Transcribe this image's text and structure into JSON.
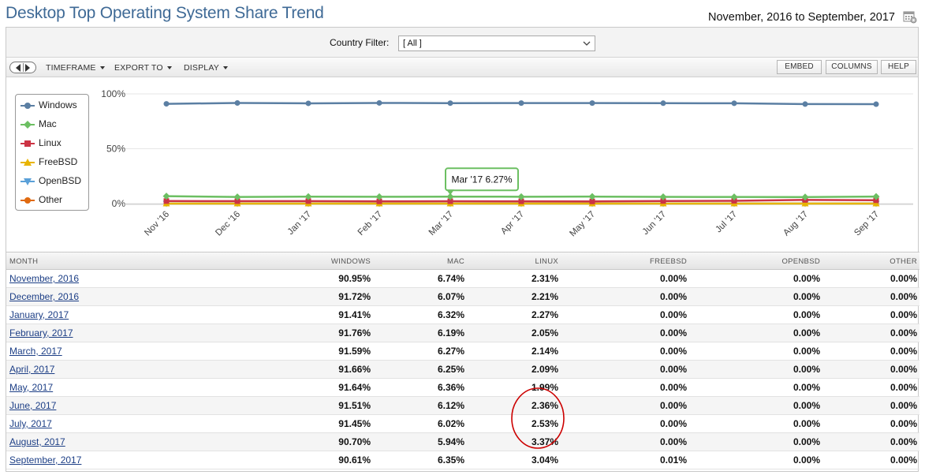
{
  "header": {
    "title": "Desktop Top Operating System Share Trend",
    "date_range": "November, 2016 to September, 2017"
  },
  "filter": {
    "label": "Country Filter:",
    "value": "[ All ]"
  },
  "toolbar": {
    "timeframe": "TIMEFRAME",
    "export": "EXPORT TO",
    "display": "DISPLAY",
    "embed": "EMBED",
    "columns": "COLUMNS",
    "help": "HELP"
  },
  "chart_data": {
    "type": "line",
    "x": [
      "Nov '16",
      "Dec '16",
      "Jan '17",
      "Feb '17",
      "Mar '17",
      "Apr '17",
      "May '17",
      "Jun '17",
      "Jul '17",
      "Aug '17",
      "Sep '17"
    ],
    "yticks": [
      "100%",
      "50%",
      "0%"
    ],
    "ylim": [
      0,
      100
    ],
    "legend_position": "top-left",
    "tooltip": {
      "index": 4,
      "series": "Mac",
      "text": "Mar '17 6.27%"
    },
    "series": [
      {
        "name": "Windows",
        "color": "#5b7fa3",
        "marker": "circle",
        "values": [
          90.95,
          91.72,
          91.41,
          91.76,
          91.59,
          91.66,
          91.64,
          91.51,
          91.45,
          90.7,
          90.61
        ]
      },
      {
        "name": "Mac",
        "color": "#6cbf62",
        "marker": "diamond",
        "values": [
          6.74,
          6.07,
          6.32,
          6.19,
          6.27,
          6.25,
          6.36,
          6.12,
          6.02,
          5.94,
          6.35
        ]
      },
      {
        "name": "Linux",
        "color": "#cc3344",
        "marker": "square",
        "values": [
          2.31,
          2.21,
          2.27,
          2.05,
          2.14,
          2.09,
          1.99,
          2.36,
          2.53,
          3.37,
          3.04
        ]
      },
      {
        "name": "FreeBSD",
        "color": "#e8b400",
        "marker": "triangle",
        "values": [
          0.0,
          0.0,
          0.0,
          0.0,
          0.0,
          0.0,
          0.0,
          0.0,
          0.0,
          0.0,
          0.01
        ]
      },
      {
        "name": "OpenBSD",
        "color": "#5aa0d8",
        "marker": "triangle-down",
        "values": [
          0.0,
          0.0,
          0.0,
          0.0,
          0.0,
          0.0,
          0.0,
          0.0,
          0.0,
          0.0,
          0.0
        ]
      },
      {
        "name": "Other",
        "color": "#e06a10",
        "marker": "circle",
        "values": [
          0.0,
          0.0,
          0.0,
          0.0,
          0.0,
          0.0,
          0.0,
          0.0,
          0.0,
          0.0,
          0.0
        ]
      }
    ]
  },
  "table": {
    "columns": [
      "MONTH",
      "WINDOWS",
      "MAC",
      "LINUX",
      "FREEBSD",
      "OPENBSD",
      "OTHER"
    ],
    "rows": [
      [
        "November, 2016",
        "90.95%",
        "6.74%",
        "2.31%",
        "0.00%",
        "0.00%",
        "0.00%"
      ],
      [
        "December, 2016",
        "91.72%",
        "6.07%",
        "2.21%",
        "0.00%",
        "0.00%",
        "0.00%"
      ],
      [
        "January, 2017",
        "91.41%",
        "6.32%",
        "2.27%",
        "0.00%",
        "0.00%",
        "0.00%"
      ],
      [
        "February, 2017",
        "91.76%",
        "6.19%",
        "2.05%",
        "0.00%",
        "0.00%",
        "0.00%"
      ],
      [
        "March, 2017",
        "91.59%",
        "6.27%",
        "2.14%",
        "0.00%",
        "0.00%",
        "0.00%"
      ],
      [
        "April, 2017",
        "91.66%",
        "6.25%",
        "2.09%",
        "0.00%",
        "0.00%",
        "0.00%"
      ],
      [
        "May, 2017",
        "91.64%",
        "6.36%",
        "1.99%",
        "0.00%",
        "0.00%",
        "0.00%"
      ],
      [
        "June, 2017",
        "91.51%",
        "6.12%",
        "2.36%",
        "0.00%",
        "0.00%",
        "0.00%"
      ],
      [
        "July, 2017",
        "91.45%",
        "6.02%",
        "2.53%",
        "0.00%",
        "0.00%",
        "0.00%"
      ],
      [
        "August, 2017",
        "90.70%",
        "5.94%",
        "3.37%",
        "0.00%",
        "0.00%",
        "0.00%"
      ],
      [
        "September, 2017",
        "90.61%",
        "6.35%",
        "3.04%",
        "0.01%",
        "0.00%",
        "0.00%"
      ]
    ]
  },
  "annotation": {
    "color": "#cc0000",
    "target": "linux-column-last-rows"
  }
}
